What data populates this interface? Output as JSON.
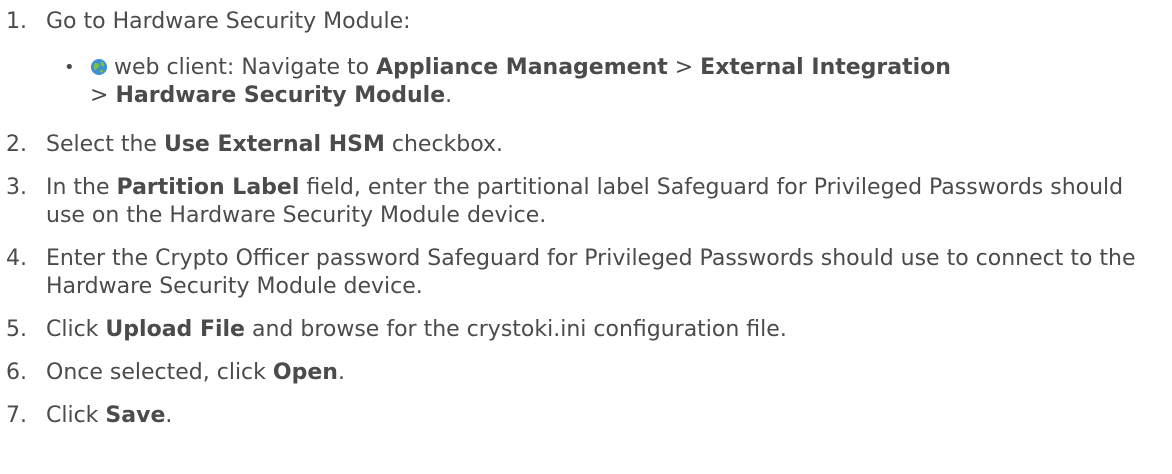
{
  "steps": [
    {
      "num": "1.",
      "pre": "Go to Hardware Security Module:"
    },
    {
      "num": "2.",
      "pre": "Select the ",
      "b1": "Use External HSM",
      "post": " checkbox."
    },
    {
      "num": "3.",
      "pre": "In the ",
      "b1": "Partition Label",
      "post": " field, enter the partitional label Safeguard for Privileged Passwords should use on the Hardware Security Module device."
    },
    {
      "num": "4.",
      "pre": "Enter the Crypto Officer password Safeguard for Privileged Passwords should use to connect to the Hardware Security Module device."
    },
    {
      "num": "5.",
      "pre": "Click ",
      "b1": "Upload File",
      "post": " and browse for the crystoki.ini configuration file."
    },
    {
      "num": "6.",
      "pre": "Once selected, click ",
      "b1": "Open",
      "post": "."
    },
    {
      "num": "7.",
      "pre": "Click ",
      "b1": "Save",
      "post": "."
    }
  ],
  "substep": {
    "bullet": "•",
    "icon": "globe-icon",
    "text1": "web client: Navigate to ",
    "b1": "Appliance Management",
    "sep1": " > ",
    "b2": "External Integration",
    "sep2": " > ",
    "b3": "Hardware Security Module",
    "end": "."
  }
}
